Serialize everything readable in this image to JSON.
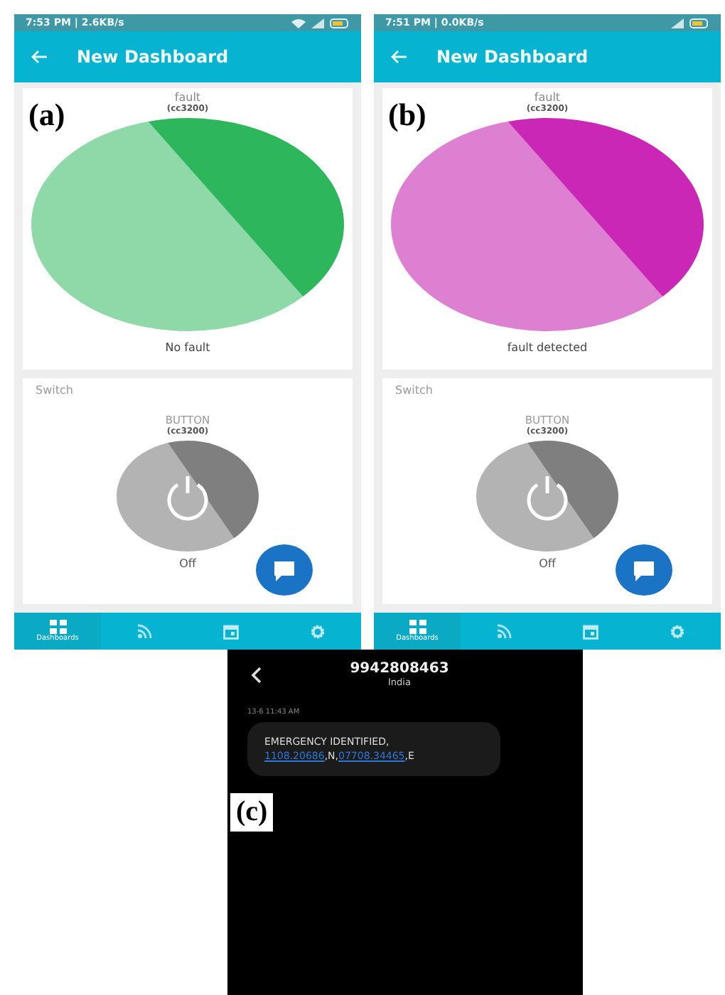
{
  "panels": [
    {
      "label": "(a)",
      "status_time": "7:53 PM | 2.6KB/s",
      "wifi": true,
      "title": "New Dashboard",
      "fault_widget": {
        "title": "fault",
        "device": "(cc3200)",
        "fault_detected": false,
        "status": "No fault"
      },
      "switch_widget": {
        "title": "Switch",
        "label": "BUTTON",
        "device": "(cc3200)",
        "on": false,
        "state": "Off"
      },
      "nav": [
        {
          "kind": "dashboards",
          "label": "Dashboards",
          "selected": true
        },
        {
          "kind": "feed",
          "selected": false
        },
        {
          "kind": "calendar",
          "selected": false
        },
        {
          "kind": "settings",
          "selected": false
        }
      ]
    },
    {
      "label": "(b)",
      "status_time": "7:51 PM | 0.0KB/s",
      "wifi": false,
      "title": "New Dashboard",
      "fault_widget": {
        "title": "fault",
        "device": "(cc3200)",
        "fault_detected": true,
        "status": "fault detected"
      },
      "switch_widget": {
        "title": "Switch",
        "label": "BUTTON",
        "device": "(cc3200)",
        "on": false,
        "state": "Off"
      },
      "nav": [
        {
          "kind": "dashboards",
          "label": "Dashboards",
          "selected": true
        },
        {
          "kind": "feed",
          "selected": false
        },
        {
          "kind": "calendar",
          "selected": false
        },
        {
          "kind": "settings",
          "selected": false
        }
      ]
    }
  ],
  "sms": {
    "label": "(c)",
    "sender": "9942808463",
    "region": "India",
    "timestamp": "13-6 11:43 AM",
    "message_line": "EMERGENCY IDENTIFIED,",
    "parts": [
      {
        "kind": "link",
        "text": "1108.20686"
      },
      {
        "kind": "plain",
        "text": ",N,"
      },
      {
        "kind": "link",
        "text": "07708.34465"
      },
      {
        "kind": "plain",
        "text": ",E"
      }
    ]
  }
}
